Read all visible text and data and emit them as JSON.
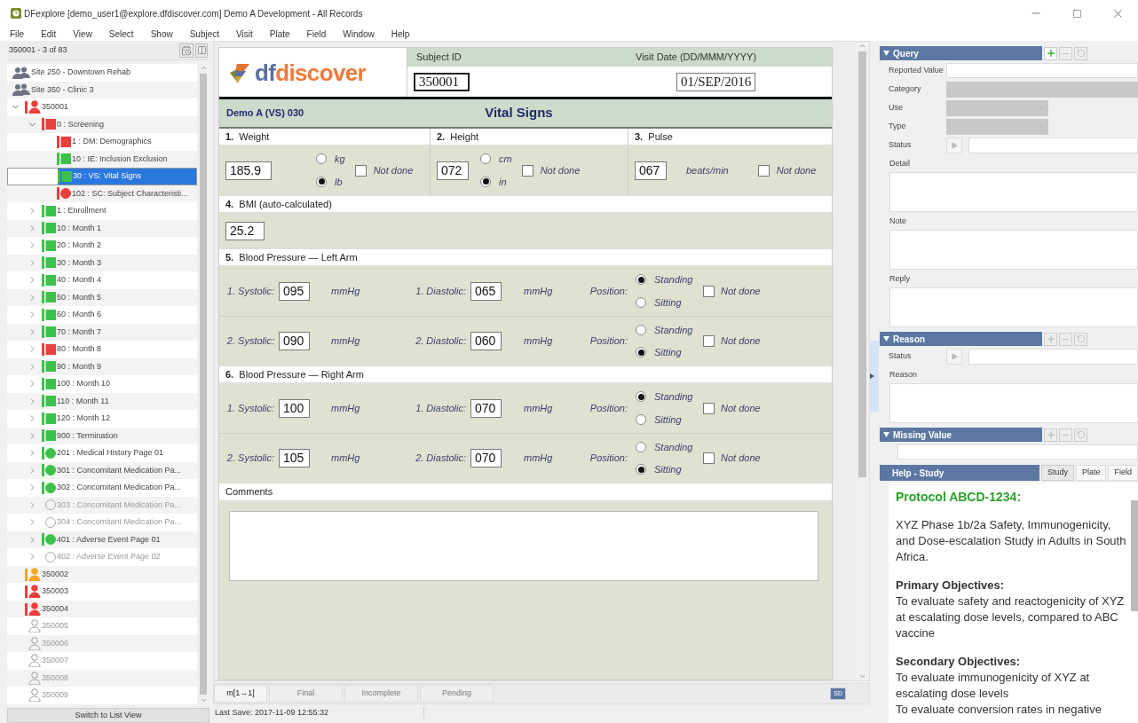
{
  "window": {
    "title": "DFexplore [demo_user1@explore.dfdiscover.com] Demo A Development - All Records"
  },
  "menu": [
    "File",
    "Edit",
    "View",
    "Select",
    "Show",
    "Subject",
    "Visit",
    "Plate",
    "Field",
    "Window",
    "Help"
  ],
  "navigator": {
    "position": "350001 - 3 of 83",
    "switch_button": "Switch to List View",
    "tree": [
      {
        "label": "Site 250 - Downtown Rehab",
        "kind": "site",
        "selected": false
      },
      {
        "label": "Site 350 - Clinic 3",
        "kind": "site",
        "selected": false
      },
      {
        "label": "350001",
        "kind": "subject",
        "color": "#e8403c",
        "selected": false,
        "expanded": true,
        "children": [
          {
            "label": "0 : Screening",
            "kind": "visit",
            "round": false,
            "color": "#e8403c",
            "selected": false,
            "expanded": true,
            "children": [
              {
                "label": "1 : DM: Demographics",
                "kind": "plate",
                "round": false,
                "color": "#e8403c",
                "selected": false
              },
              {
                "label": "10 : IE: Inclusion Exclusion",
                "kind": "plate",
                "round": false,
                "color": "#3ec14a",
                "selected": false
              },
              {
                "label": "30 : VS: Vital Signs",
                "kind": "plate",
                "round": false,
                "color": "#3ec14a",
                "selected": true
              },
              {
                "label": "102 : SC: Subject Characteristi...",
                "kind": "plate",
                "round": true,
                "color": "#e8403c",
                "selected": false
              }
            ]
          },
          {
            "label": "1 : Enrollment",
            "kind": "visit",
            "round": false,
            "color": "#3ec14a",
            "selected": false,
            "expanded": false
          },
          {
            "label": "10 : Month 1",
            "kind": "visit",
            "round": false,
            "color": "#3ec14a",
            "selected": false,
            "expanded": false
          },
          {
            "label": "20 : Month 2",
            "kind": "visit",
            "round": false,
            "color": "#3ec14a",
            "selected": false,
            "expanded": false
          },
          {
            "label": "30 : Month 3",
            "kind": "visit",
            "round": false,
            "color": "#3ec14a",
            "selected": false,
            "expanded": false
          },
          {
            "label": "40 : Month 4",
            "kind": "visit",
            "round": false,
            "color": "#3ec14a",
            "selected": false,
            "expanded": false
          },
          {
            "label": "50 : Month 5",
            "kind": "visit",
            "round": false,
            "color": "#3ec14a",
            "selected": false,
            "expanded": false
          },
          {
            "label": "60 : Month 6",
            "kind": "visit",
            "round": false,
            "color": "#3ec14a",
            "selected": false,
            "expanded": false
          },
          {
            "label": "70 : Month 7",
            "kind": "visit",
            "round": false,
            "color": "#3ec14a",
            "selected": false,
            "expanded": false
          },
          {
            "label": "80 : Month 8",
            "kind": "visit",
            "round": false,
            "color": "#e8403c",
            "selected": false,
            "expanded": false
          },
          {
            "label": "90 : Month 9",
            "kind": "visit",
            "round": false,
            "color": "#3ec14a",
            "selected": false,
            "expanded": false
          },
          {
            "label": "100 : Month 10",
            "kind": "visit",
            "round": false,
            "color": "#3ec14a",
            "selected": false,
            "expanded": false
          },
          {
            "label": "110 : Month 11",
            "kind": "visit",
            "round": false,
            "color": "#3ec14a",
            "selected": false,
            "expanded": false
          },
          {
            "label": "120 : Month 12",
            "kind": "visit",
            "round": false,
            "color": "#3ec14a",
            "selected": false,
            "expanded": false
          },
          {
            "label": "900 : Termination",
            "kind": "visit",
            "round": false,
            "color": "#3ec14a",
            "selected": false,
            "expanded": false
          },
          {
            "label": "201 : Medical History Page 01",
            "kind": "visit",
            "round": true,
            "color": "#3ec14a",
            "selected": false,
            "expanded": false
          },
          {
            "label": "301 : Concomitant Medication Pa...",
            "kind": "visit",
            "round": true,
            "color": "#3ec14a",
            "selected": false,
            "expanded": false
          },
          {
            "label": "302 : Concomitant Medication Pa...",
            "kind": "visit",
            "round": true,
            "color": "#3ec14a",
            "selected": false,
            "expanded": false
          },
          {
            "label": "303 : Concomitant Medication Pa...",
            "kind": "visit",
            "round": true,
            "selected": false,
            "expanded": false
          },
          {
            "label": "304 : Concomitant Medication Pa...",
            "kind": "visit",
            "round": true,
            "selected": false,
            "expanded": false
          },
          {
            "label": "401 : Adverse Event Page 01",
            "kind": "visit",
            "round": true,
            "color": "#3ec14a",
            "selected": false,
            "expanded": false
          },
          {
            "label": "402 : Adverse Event Page 02",
            "kind": "visit",
            "round": true,
            "selected": false,
            "expanded": false
          }
        ]
      },
      {
        "label": "350002",
        "kind": "subject",
        "color": "#f5a623",
        "selected": false
      },
      {
        "label": "350003",
        "kind": "subject",
        "color": "#e8403c",
        "selected": false
      },
      {
        "label": "350004",
        "kind": "subject",
        "color": "#e8403c",
        "selected": false
      },
      {
        "label": "350005",
        "kind": "subject",
        "selected": false
      },
      {
        "label": "350006",
        "kind": "subject",
        "selected": false
      },
      {
        "label": "350007",
        "kind": "subject",
        "selected": false
      },
      {
        "label": "350008",
        "kind": "subject",
        "selected": false
      },
      {
        "label": "350009",
        "kind": "subject",
        "selected": false
      }
    ]
  },
  "form": {
    "logo_text": "dfdiscover",
    "subject_id": {
      "label": "Subject ID",
      "value": "350001"
    },
    "visit_date": {
      "label": "Visit Date (DD/MMM/YYYY)",
      "value": "01/SEP/2016"
    },
    "code": "Demo A (VS) 030",
    "title": "Vital Signs",
    "measures": [
      {
        "number": "1.",
        "label": "Weight",
        "value": "185.9",
        "units": [
          {
            "label": "kg",
            "selected": false
          },
          {
            "label": "lb",
            "selected": true
          }
        ],
        "not_done": {
          "label": "Not done",
          "checked": false
        }
      },
      {
        "number": "2.",
        "label": "Height",
        "value": "072",
        "units": [
          {
            "label": "cm",
            "selected": false
          },
          {
            "label": "in",
            "selected": true
          }
        ],
        "not_done": {
          "label": "Not done",
          "checked": false
        }
      },
      {
        "number": "3.",
        "label": "Pulse",
        "value": "067",
        "unit": "beats/min",
        "not_done": {
          "label": "Not done",
          "checked": false
        }
      }
    ],
    "bmi": {
      "number": "4.",
      "label": "BMI (auto-calculated)",
      "value": "25.2"
    },
    "blood_pressure": [
      {
        "number": "5.",
        "label": "Blood Pressure — Left Arm",
        "readings": [
          {
            "systolic_label": "1. Systolic:",
            "systolic": "095",
            "systolic_unit": "mmHg",
            "diastolic_label": "1. Diastolic:",
            "diastolic": "065",
            "diastolic_unit": "mmHg",
            "position_label": "Position:",
            "positions": [
              {
                "label": "Standing",
                "selected": true
              },
              {
                "label": "Sitting",
                "selected": false
              }
            ],
            "not_done": {
              "label": "Not done",
              "checked": false
            }
          },
          {
            "systolic_label": "2. Systolic:",
            "systolic": "090",
            "systolic_unit": "mmHg",
            "diastolic_label": "2. Diastolic:",
            "diastolic": "060",
            "diastolic_unit": "mmHg",
            "position_label": "Position:",
            "positions": [
              {
                "label": "Standing",
                "selected": false
              },
              {
                "label": "Sitting",
                "selected": true
              }
            ],
            "not_done": {
              "label": "Not done",
              "checked": false
            }
          }
        ]
      },
      {
        "number": "6.",
        "label": "Blood Pressure — Right Arm",
        "readings": [
          {
            "systolic_label": "1. Systolic:",
            "systolic": "100",
            "systolic_unit": "mmHg",
            "diastolic_label": "1. Diastolic:",
            "diastolic": "070",
            "diastolic_unit": "mmHg",
            "position_label": "Position:",
            "positions": [
              {
                "label": "Standing",
                "selected": true
              },
              {
                "label": "Sitting",
                "selected": false
              }
            ],
            "not_done": {
              "label": "Not done",
              "checked": false
            }
          },
          {
            "systolic_label": "2. Systolic:",
            "systolic": "105",
            "systolic_unit": "mmHg",
            "diastolic_label": "2. Diastolic:",
            "diastolic": "070",
            "diastolic_unit": "mmHg",
            "position_label": "Position:",
            "positions": [
              {
                "label": "Standing",
                "selected": false
              },
              {
                "label": "Sitting",
                "selected": true
              }
            ],
            "not_done": {
              "label": "Not done",
              "checked": false
            }
          }
        ]
      }
    ],
    "comments": {
      "label": "Comments"
    }
  },
  "form_footer": {
    "buttons": [
      {
        "label": "m[1→1]",
        "disabled": false
      },
      {
        "label": "Final",
        "disabled": true
      },
      {
        "label": "Incomplete",
        "disabled": true
      },
      {
        "label": "Pending",
        "disabled": true
      }
    ],
    "sd_button": "SD",
    "last_save": "Last Save: 2017-11-09 12:55:32"
  },
  "panels": [
    {
      "title": "Query",
      "add_enabled": true,
      "fields": [
        {
          "kind": "input",
          "label": "Reported Value"
        },
        {
          "kind": "combo",
          "label": "Category"
        },
        {
          "kind": "select",
          "label": "Use"
        },
        {
          "kind": "select",
          "label": "Type"
        },
        {
          "kind": "status",
          "label": "Status"
        },
        {
          "kind": "memo",
          "label": "Detail"
        },
        {
          "kind": "memo",
          "label": "Note"
        },
        {
          "kind": "memo",
          "label": "Reply"
        }
      ]
    },
    {
      "title": "Reason",
      "add_enabled": false,
      "fields": [
        {
          "kind": "status",
          "label": "Status"
        },
        {
          "kind": "memo",
          "label": "Reason"
        }
      ]
    },
    {
      "title": "Missing Value",
      "add_enabled": false,
      "fields": [
        {
          "kind": "input"
        }
      ]
    }
  ],
  "help": {
    "title": "Help - Study",
    "tabs": [
      {
        "label": "Study",
        "selected": true
      },
      {
        "label": "Plate",
        "selected": false
      },
      {
        "label": "Field",
        "selected": false
      }
    ],
    "content": [
      {
        "kind": "title",
        "text": "Protocol ABCD-1234:"
      },
      {
        "kind": "paragraph",
        "text": "XYZ Phase 1b/2a Safety, Immunogenicity, and Dose-escalation Study in Adults in South Africa."
      },
      {
        "kind": "heading",
        "text": "Primary Objectives:"
      },
      {
        "kind": "line",
        "text": "To evaluate safety and reactogenicity of XYZ at escalating dose levels, compared to ABC vaccine"
      },
      {
        "kind": "heading",
        "text": "Secondary Objectives:"
      },
      {
        "kind": "line",
        "text": "To evaluate immunogenicity of XYZ at escalating dose levels"
      },
      {
        "kind": "line",
        "text": "To evaluate conversion rates in negative"
      }
    ]
  }
}
